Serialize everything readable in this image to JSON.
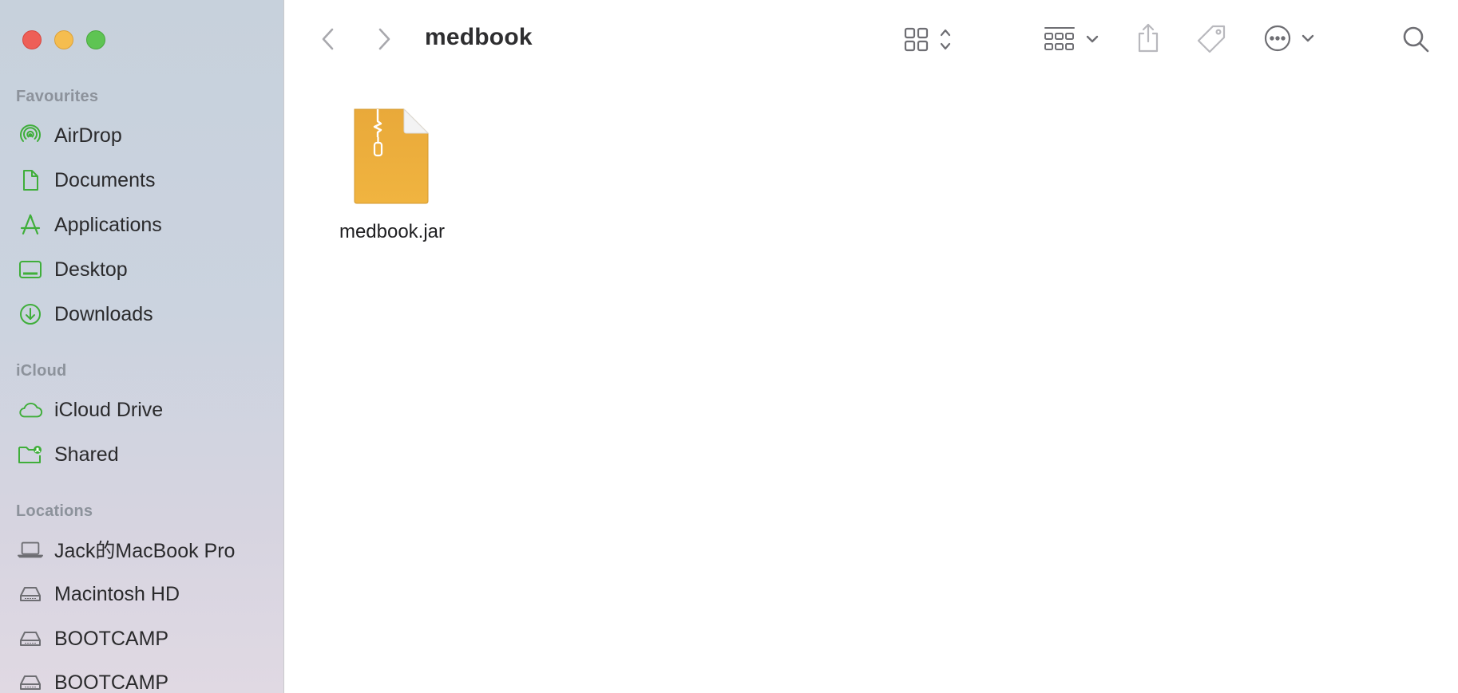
{
  "window": {
    "title": "medbook"
  },
  "sidebar": {
    "sections": [
      {
        "header": "Favourites",
        "items": [
          {
            "label": "AirDrop",
            "icon": "airdrop-icon"
          },
          {
            "label": "Documents",
            "icon": "document-icon"
          },
          {
            "label": "Applications",
            "icon": "applications-icon"
          },
          {
            "label": "Desktop",
            "icon": "desktop-icon"
          },
          {
            "label": "Downloads",
            "icon": "downloads-icon"
          }
        ]
      },
      {
        "header": "iCloud",
        "items": [
          {
            "label": "iCloud Drive",
            "icon": "cloud-icon"
          },
          {
            "label": "Shared",
            "icon": "shared-folder-icon"
          }
        ]
      },
      {
        "header": "Locations",
        "items": [
          {
            "label": "Jack的MacBook Pro",
            "icon": "laptop-icon"
          },
          {
            "label": "Macintosh HD",
            "icon": "disk-icon"
          },
          {
            "label": "BOOTCAMP",
            "icon": "disk-icon"
          },
          {
            "label": "BOOTCAMP",
            "icon": "disk-icon"
          }
        ]
      }
    ]
  },
  "toolbar": {
    "back_icon": "chevron-left-icon",
    "forward_icon": "chevron-right-icon",
    "view_icon": "icon-grid-view-icon",
    "group_icon": "group-by-icon",
    "share_icon": "share-icon",
    "tag_icon": "tag-icon",
    "more_icon": "more-actions-icon",
    "search_icon": "search-icon"
  },
  "files": [
    {
      "name": "medbook.jar",
      "icon": "jar-archive-icon"
    }
  ],
  "colors": {
    "accent_green": "#3fae3a",
    "folder_orange": "#e9a93a"
  }
}
